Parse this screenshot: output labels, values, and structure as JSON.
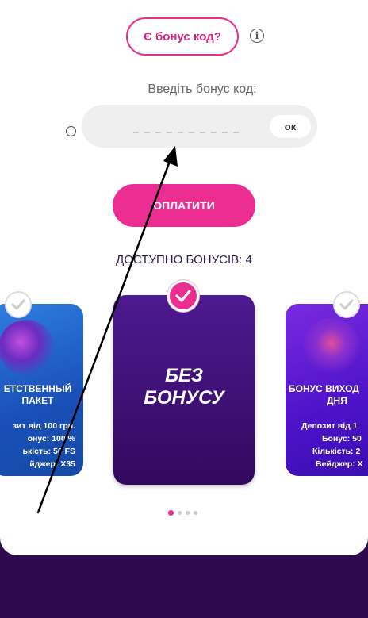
{
  "header": {
    "bonus_code_button": "Є бонус код?",
    "info_icon": "info-icon"
  },
  "code_entry": {
    "label": "Введіть бонус код:",
    "placeholder": "_ _ _ _ _ _ _ _ _ _",
    "ok_label": "ок"
  },
  "pay_button": "ОПЛАТИТИ",
  "available_bonuses": "ДОСТУПНО БОНУСІВ: 4",
  "cards": [
    {
      "title_lines": [
        "ЕТСТВЕННЫЙ",
        "ПАКЕТ"
      ],
      "details": [
        "зит від 100 грн.",
        "онус: 100 %",
        "ькість: 50 FS",
        "йджер: X35"
      ],
      "selected": false
    },
    {
      "title_lines": [
        "БЕЗ",
        "БОНУСУ"
      ],
      "selected": true
    },
    {
      "title_lines": [
        "БОНУС ВИХОД",
        "ДНЯ"
      ],
      "details": [
        "Депозит від 1",
        "Бонус: 50",
        "Кількість: 2",
        "Вейджер: X"
      ],
      "selected": false
    }
  ],
  "pagination": {
    "total": 4,
    "active": 1
  },
  "colors": {
    "accent": "#ec2e92",
    "background": "#2e0a4d",
    "center_card": "#3b0c6e"
  }
}
